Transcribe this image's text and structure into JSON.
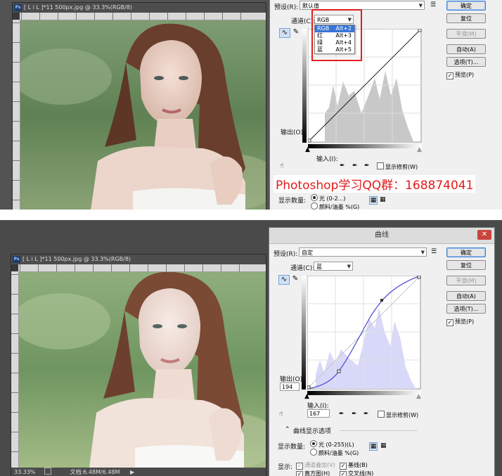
{
  "top": {
    "doc": {
      "tab_title": "[ L i L ]*11   500px.jpg @ 33.3%(RGB/8)",
      "ruler_h": [
        "0",
        "2",
        "4",
        "6",
        "8",
        "10",
        "12",
        "14",
        "16",
        "18",
        "20",
        "22",
        "24"
      ],
      "ruler_v": [
        "0",
        "2",
        "4",
        "6",
        "8",
        "10",
        "12",
        "14",
        "16",
        "18"
      ]
    },
    "dialog": {
      "preset_label": "预设(R):",
      "preset_value": "默认值",
      "channel_label": "通道(C):",
      "channel_value": "RGB",
      "channel_options": [
        {
          "label": "RGB",
          "shortcut": "Alt+2"
        },
        {
          "label": "红",
          "shortcut": "Alt+3"
        },
        {
          "label": "绿",
          "shortcut": "Alt+4"
        },
        {
          "label": "蓝",
          "shortcut": "Alt+5"
        }
      ],
      "buttons": {
        "ok": "确定",
        "reset": "复位",
        "smooth": "平滑(M)",
        "auto": "自动(A)",
        "options": "选项(T)..."
      },
      "preview_label": "预览(P)",
      "output_label": "输出(O):",
      "input_label": "输入(I):",
      "show_clipping_label": "显示修剪(W)",
      "display_amount_label": "显示数量:",
      "light_option": "光 (0-2...)",
      "pigment_option": "颜料/油墨 %(G)"
    },
    "watermark": "Photoshop学习QQ群：168874041"
  },
  "bottom": {
    "doc": {
      "tab_title": "[ L i L ]*11   500px.jpg @ 33.3%(RGB/8)",
      "ruler_h": [
        "0",
        "2",
        "4",
        "6",
        "8",
        "10",
        "12",
        "14",
        "16",
        "18",
        "20",
        "22",
        "24"
      ],
      "ruler_v": [
        "0",
        "2",
        "4",
        "6",
        "8",
        "10",
        "12",
        "14",
        "16",
        "18"
      ],
      "status_zoom": "33.33%",
      "status_doc": "文档:6.48M/6.48M"
    },
    "dialog": {
      "title": "曲线",
      "close_icon": "close-icon",
      "preset_label": "预设(R):",
      "preset_value": "自定",
      "channel_label": "通道(C):",
      "channel_value": "蓝",
      "buttons": {
        "ok": "确定",
        "reset": "复位",
        "smooth": "平滑(M)",
        "auto": "自动(A)",
        "options": "选项(T)..."
      },
      "preview_label": "预览(P)",
      "output_label": "输出(O):",
      "output_value": "194",
      "input_label": "输入(I):",
      "input_value": "167",
      "show_clipping_label": "显示修剪(W)",
      "curve_options_label": "曲线显示选项",
      "display_amount_label": "显示数量:",
      "light_option": "光 (0-255)(L)",
      "pigment_option": "颜料/油墨 %(G)",
      "show_label": "显示:",
      "show_options": [
        {
          "label": "通道叠加(V)",
          "checked": true,
          "disabled": true
        },
        {
          "label": "基线(B)",
          "checked": true,
          "disabled": false
        },
        {
          "label": "直方图(H)",
          "checked": true,
          "disabled": false
        },
        {
          "label": "交叉线(N)",
          "checked": true,
          "disabled": false
        }
      ]
    }
  }
}
